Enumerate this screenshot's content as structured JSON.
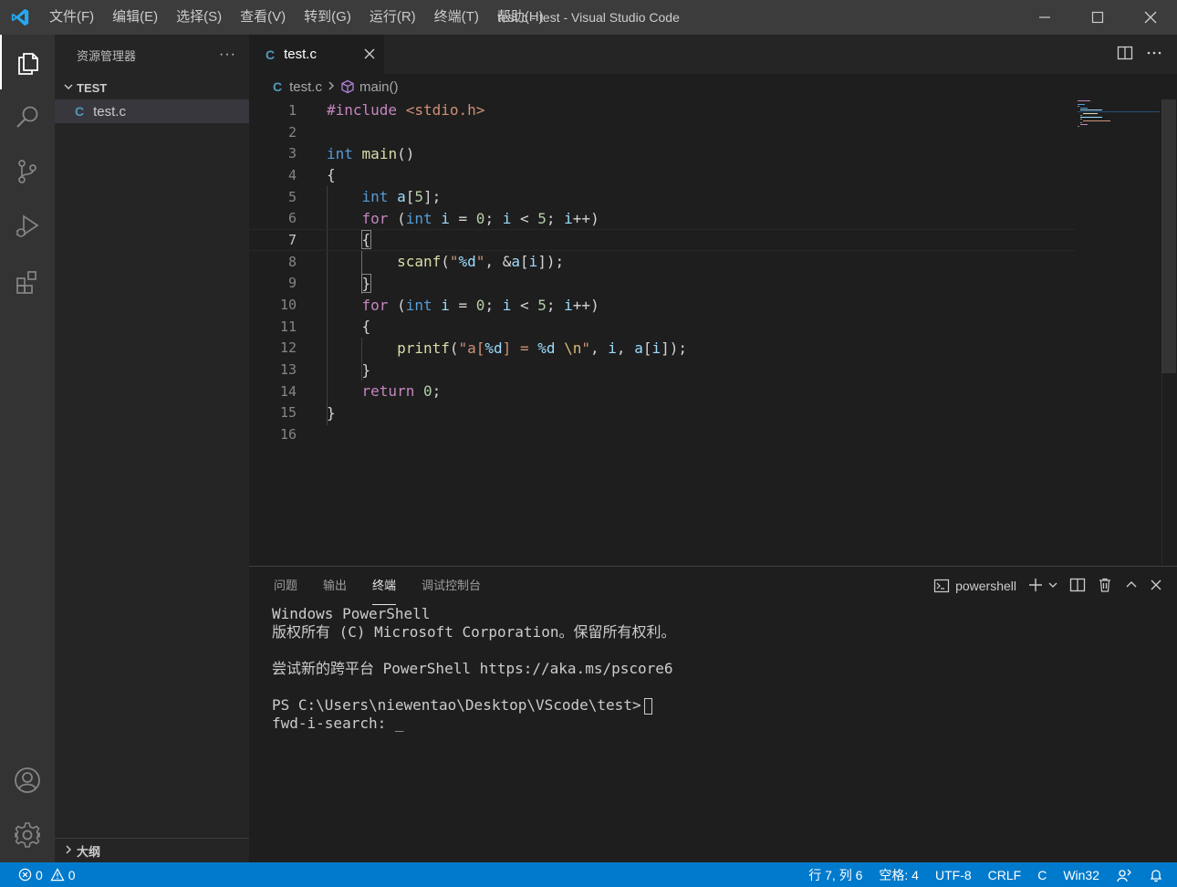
{
  "window": {
    "title": "test.c - test - Visual Studio Code",
    "menu": [
      "文件(F)",
      "编辑(E)",
      "选择(S)",
      "查看(V)",
      "转到(G)",
      "运行(R)",
      "终端(T)",
      "帮助(H)"
    ]
  },
  "colors": {
    "accent": "#007acc",
    "c_icon": "#519aba",
    "keyword": "#569cd6",
    "control": "#c586c0",
    "function": "#dcdcaa",
    "string": "#ce9178"
  },
  "activitybar": {
    "icons": [
      "explorer-icon",
      "search-icon",
      "source-control-icon",
      "run-debug-icon",
      "extensions-icon",
      "account-icon",
      "manage-gear-icon"
    ]
  },
  "sidebar": {
    "title": "资源管理器",
    "more": "···",
    "folder": "TEST",
    "file_icon": "C",
    "file": "test.c",
    "outline": "大纲"
  },
  "editor": {
    "tab_icon": "C",
    "tab_label": "test.c",
    "breadcrumb": {
      "file": "test.c",
      "symbol": "main()"
    },
    "current_line": 7,
    "line_numbers": [
      "1",
      "2",
      "3",
      "4",
      "5",
      "6",
      "7",
      "8",
      "9",
      "10",
      "11",
      "12",
      "13",
      "14",
      "15",
      "16"
    ],
    "lines": [
      "#include <stdio.h>",
      "",
      "int main()",
      "{",
      "    int a[5];",
      "    for (int i = 0; i < 5; i++)",
      "    {",
      "        scanf(\"%d\", &a[i]);",
      "    }",
      "    for (int i = 0; i < 5; i++)",
      "    {",
      "        printf(\"a[%d] = %d \\n\", i, a[i]);",
      "    }",
      "    return 0;",
      "}",
      ""
    ]
  },
  "panel": {
    "tabs": [
      "问题",
      "输出",
      "终端",
      "调试控制台"
    ],
    "active_tab": "终端",
    "terminal_name": "powershell",
    "terminal_lines": [
      "Windows PowerShell",
      "版权所有 (C) Microsoft Corporation。保留所有权利。",
      "",
      "尝试新的跨平台 PowerShell https://aka.ms/pscore6",
      "",
      "PS C:\\Users\\niewentao\\Desktop\\VScode\\test>",
      "fwd-i-search: _"
    ]
  },
  "statusbar": {
    "errors": "0",
    "warnings": "0",
    "position": "行 7, 列 6",
    "indent": "空格: 4",
    "encoding": "UTF-8",
    "eol": "CRLF",
    "language": "C",
    "platform": "Win32"
  }
}
